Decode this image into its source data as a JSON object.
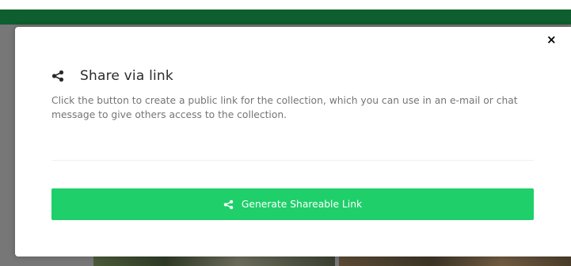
{
  "dialog": {
    "close_symbol": "×",
    "title": "Share via link",
    "title_icon": "share-icon",
    "description": "Click the button to create a public link for the collection, which you can use in an e-mail or chat message to give others access to the collection.",
    "generate_button": {
      "label": "Generate Shareable Link",
      "icon": "share-icon"
    }
  },
  "colors": {
    "topbar": "#0f5e2f",
    "overlay": "#777777",
    "button": "#1fcf6a",
    "title_text": "#2b2b2b",
    "description_text": "#757575"
  }
}
